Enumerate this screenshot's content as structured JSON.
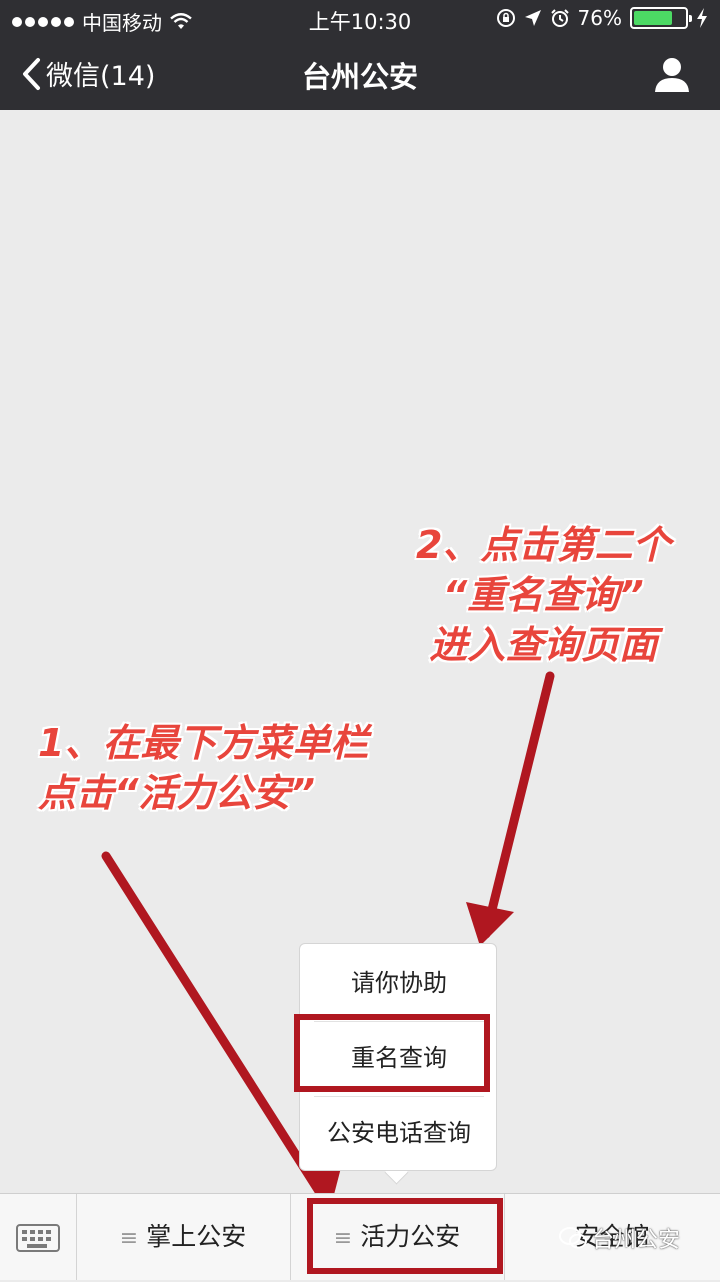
{
  "status_bar": {
    "carrier": "中国移动",
    "time": "上午10:30",
    "battery_percent": "76%",
    "battery_level": 0.76
  },
  "nav": {
    "back_label": "微信(14)",
    "title": "台州公安"
  },
  "annotations": {
    "step1_line1": "1、在最下方菜单栏",
    "step1_line2": "点击“活力公安”",
    "step2_line1": "2、点击第二个",
    "step2_line2": "“重名查询”",
    "step2_line3": "进入查询页面",
    "color": "#e8453c"
  },
  "submenu": {
    "items": [
      "请你协助",
      "重名查询",
      "公安电话查询"
    ]
  },
  "menubar": {
    "tabs": [
      "掌上公安",
      "活力公安",
      "安全馆"
    ]
  },
  "watermark": "台州公安",
  "colors": {
    "header_bg": "#2f2f33",
    "highlight_box": "#b01720",
    "battery_fill": "#4cd964"
  }
}
